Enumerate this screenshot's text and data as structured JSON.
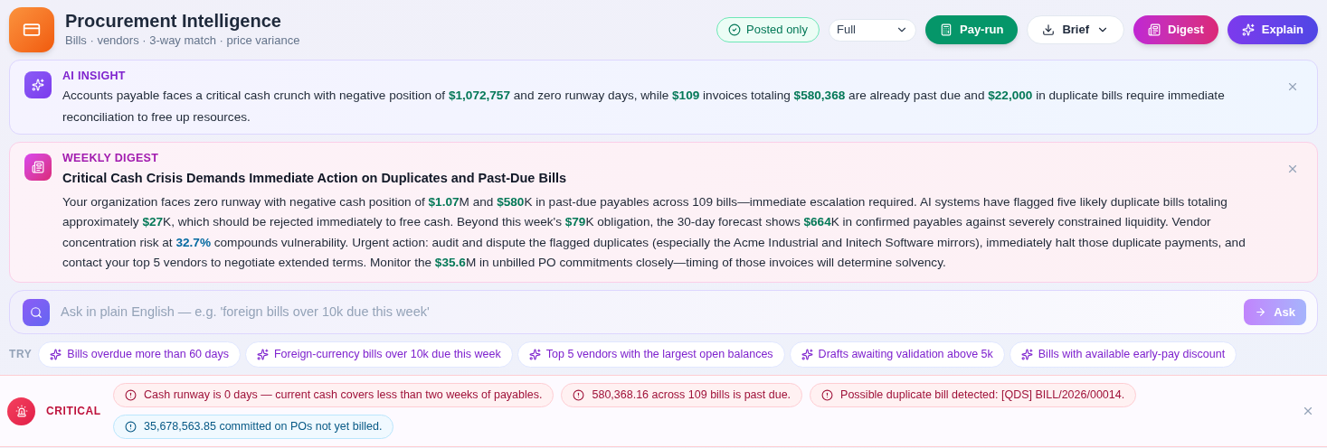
{
  "header": {
    "title": "Procurement Intelligence",
    "subtitle": "Bills · vendors · 3-way match · price variance"
  },
  "toolbar": {
    "posted_only": {
      "label": "Posted only",
      "on": true
    },
    "view_select": {
      "value": "Full"
    },
    "buttons": [
      {
        "label": "Pay-run",
        "kind": "payrun"
      },
      {
        "label": "Brief",
        "kind": "brief"
      },
      {
        "label": "Digest",
        "kind": "digest"
      },
      {
        "label": "Explain",
        "kind": "explain"
      }
    ]
  },
  "insight": {
    "label": "AI INSIGHT",
    "segments": [
      {
        "kind": "plain",
        "text": "Accounts payable faces a critical cash crunch with negative position of "
      },
      {
        "kind": "money",
        "text": "$1,072,757"
      },
      {
        "kind": "plain",
        "text": " and zero runway days, while "
      },
      {
        "kind": "money",
        "text": "$109"
      },
      {
        "kind": "plain",
        "text": " invoices totaling "
      },
      {
        "kind": "money",
        "text": "$580,368"
      },
      {
        "kind": "plain",
        "text": " are already past due and "
      },
      {
        "kind": "money",
        "text": "$22,000"
      },
      {
        "kind": "plain",
        "text": " in duplicate bills require immediate reconciliation to free up resources."
      }
    ]
  },
  "digest": {
    "label": "WEEKLY DIGEST",
    "title": "Critical Cash Crisis Demands Immediate Action on Duplicates and Past-Due Bills",
    "segments": [
      {
        "kind": "plain",
        "text": "Your organization faces zero runway with negative cash position of "
      },
      {
        "kind": "money",
        "text": "$1.07"
      },
      {
        "kind": "plain",
        "text": "M and "
      },
      {
        "kind": "money",
        "text": "$580"
      },
      {
        "kind": "plain",
        "text": "K in past-due payables across 109 bills—immediate escalation required. AI systems have flagged five likely duplicate bills totaling approximately "
      },
      {
        "kind": "money",
        "text": "$27"
      },
      {
        "kind": "plain",
        "text": "K, which should be rejected immediately to free cash. Beyond this week's "
      },
      {
        "kind": "money",
        "text": "$79"
      },
      {
        "kind": "plain",
        "text": "K obligation, the 30-day forecast shows "
      },
      {
        "kind": "money",
        "text": "$664"
      },
      {
        "kind": "plain",
        "text": "K in confirmed payables against severely constrained liquidity. Vendor concentration risk at "
      },
      {
        "kind": "percent",
        "text": "32.7%"
      },
      {
        "kind": "plain",
        "text": " compounds vulnerability. Urgent action: audit and dispute the flagged duplicates (especially the Acme Industrial and Initech Software mirrors), immediately halt those duplicate payments, and contact your top 5 vendors to negotiate extended terms. Monitor the "
      },
      {
        "kind": "money",
        "text": "$35.6"
      },
      {
        "kind": "plain",
        "text": "M in unbilled PO commitments closely—timing of those invoices will determine solvency."
      }
    ]
  },
  "ask": {
    "placeholder": "Ask in plain English — e.g. 'foreign bills over 10k due this week'",
    "button": "Ask"
  },
  "try": {
    "label": "TRY",
    "suggestions": [
      "Bills overdue more than 60 days",
      "Foreign-currency bills over 10k due this week",
      "Top 5 vendors with the largest open balances",
      "Drafts awaiting validation above 5k",
      "Bills with available early-pay discount"
    ]
  },
  "alerts": {
    "label": "CRITICAL",
    "items": [
      {
        "kind": "critical",
        "text": "Cash runway is 0 days — current cash covers less than two weeks of payables."
      },
      {
        "kind": "critical",
        "text": "580,368.16 across 109 bills is past due."
      },
      {
        "kind": "critical",
        "text": "Possible duplicate bill detected: [QDS] BILL/2026/00014."
      },
      {
        "kind": "info",
        "text": "35,678,563.85 committed on POs not yet billed."
      }
    ]
  }
}
